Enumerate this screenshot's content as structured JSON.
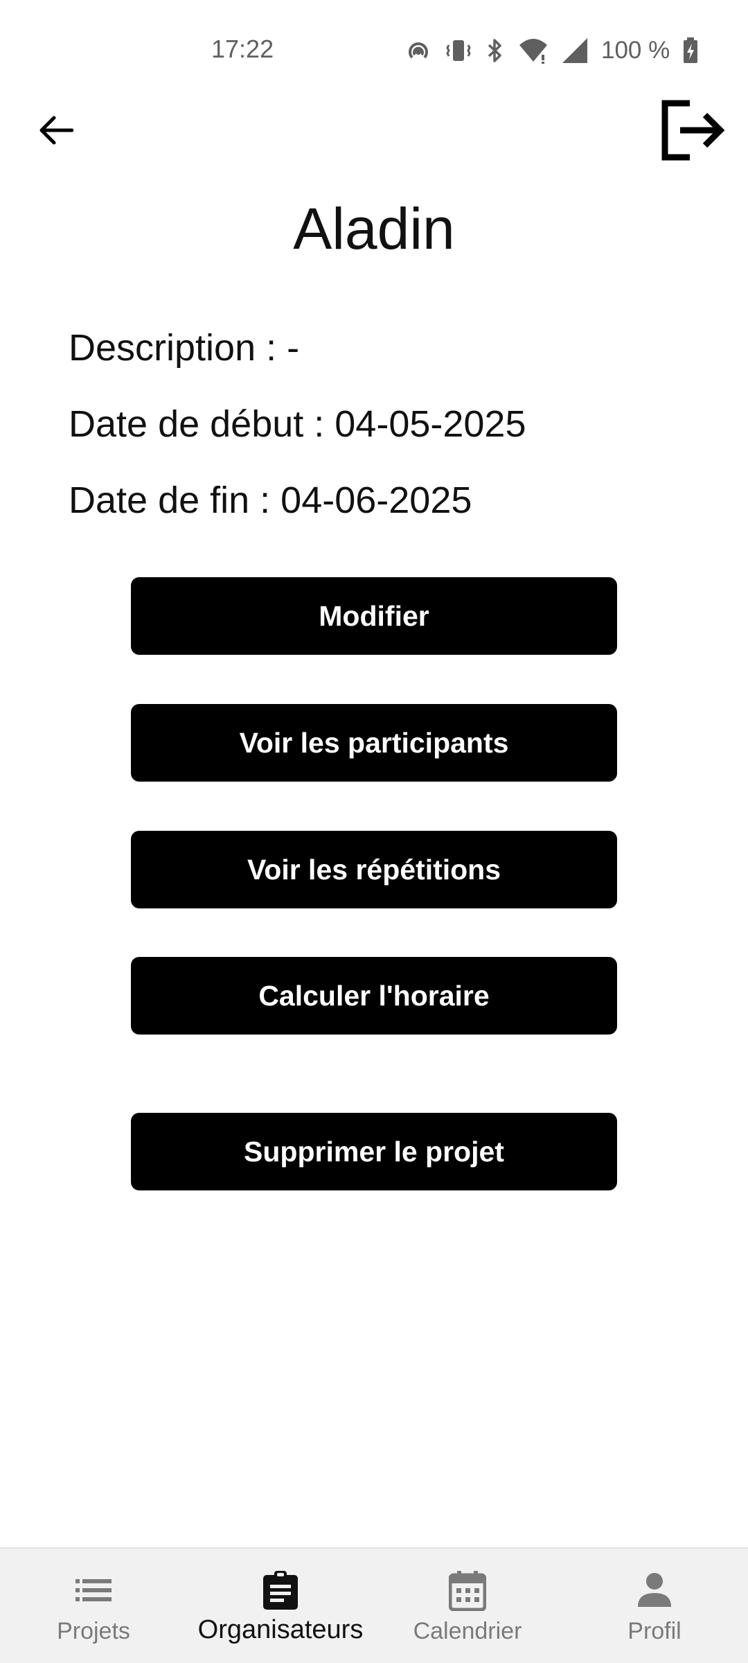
{
  "status_bar": {
    "time": "17:22",
    "battery": "100 %",
    "icons": [
      "hotspot-icon",
      "vibrate-icon",
      "bluetooth-icon",
      "wifi-icon",
      "cellular-signal-icon",
      "battery-charging-icon"
    ]
  },
  "app_bar": {
    "back_icon": "arrow-left-icon",
    "logout_icon": "logout-icon"
  },
  "project": {
    "title": "Aladin",
    "description": "Description : -",
    "start_date": "Date de début : 04-05-2025",
    "end_date": "Date de fin : 04-06-2025"
  },
  "actions": {
    "modifier": "Modifier",
    "participants": "Voir les participants",
    "repetitions": "Voir les répétitions",
    "horaire": "Calculer l'horaire",
    "supprimer": "Supprimer le projet"
  },
  "bottom_nav": {
    "items": [
      {
        "label": "Projets",
        "icon": "list-icon",
        "active": false
      },
      {
        "label": "Organisateurs",
        "icon": "clipboard-icon",
        "active": true
      },
      {
        "label": "Calendrier",
        "icon": "calendar-icon",
        "active": false
      },
      {
        "label": "Profil",
        "icon": "person-icon",
        "active": false
      }
    ]
  },
  "colors": {
    "button_bg": "#000000",
    "button_text": "#ffffff",
    "nav_bg": "#f1f1f1",
    "nav_inactive": "#7a7a7a"
  }
}
